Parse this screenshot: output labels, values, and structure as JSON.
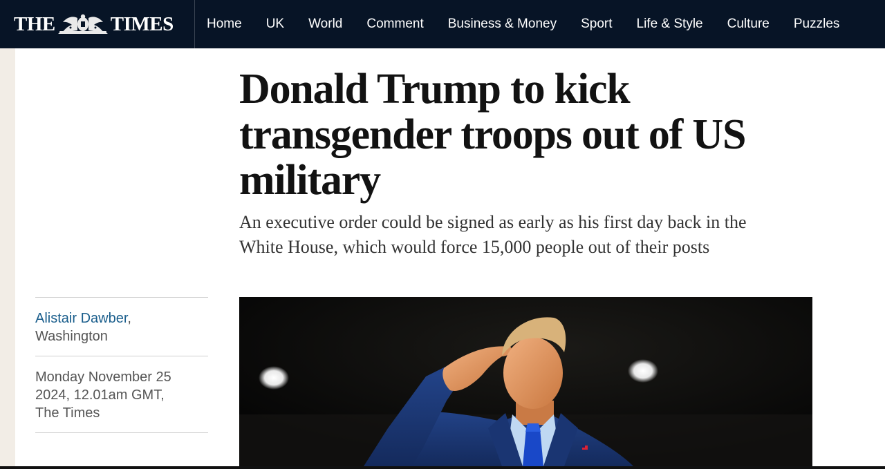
{
  "brand": {
    "logo_text_left": "THE",
    "logo_text_right": "TIMES",
    "nav_bg": "#071426"
  },
  "nav": {
    "items": [
      "Home",
      "UK",
      "World",
      "Comment",
      "Business & Money",
      "Sport",
      "Life & Style",
      "Culture",
      "Puzzles"
    ]
  },
  "article": {
    "headline": "Donald Trump to kick transgender troops out of US military",
    "standfirst": "An executive order could be signed as early as his first day back in the White House, which would force 15,000 people out of their posts",
    "author": "Alistair Dawber",
    "author_sep": ",",
    "location": "Washington",
    "date_line1": "Monday November 25",
    "date_line2": "2024, 12.01am GMT,",
    "publication": "The Times",
    "link_color": "#1a5e8c"
  }
}
